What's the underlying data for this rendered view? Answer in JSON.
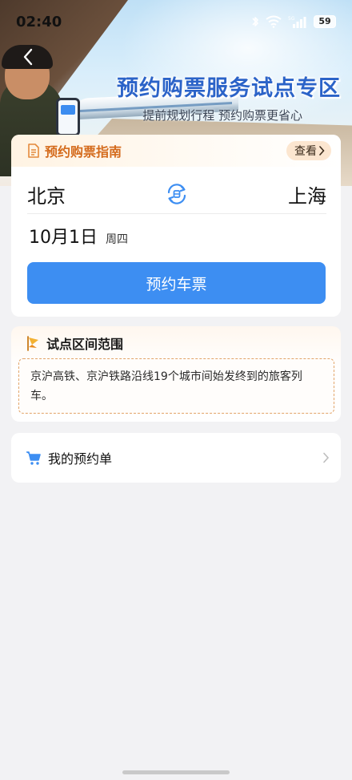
{
  "status_bar": {
    "time": "02:40",
    "battery": "59",
    "icons": [
      "bluetooth-icon",
      "wifi-icon",
      "signal-5g-icon",
      "battery-icon"
    ]
  },
  "hero": {
    "title": "预约购票服务试点专区",
    "subtitle": "提前规划行程 预约购票更省心"
  },
  "guide": {
    "title": "预约购票指南",
    "view_label": "查看"
  },
  "route": {
    "from": "北京",
    "to": "上海"
  },
  "date": {
    "date": "10月1日",
    "weekday": "周四"
  },
  "booking": {
    "button_label": "预约车票"
  },
  "scope": {
    "title": "试点区间范围",
    "description": "京沪高铁、京沪铁路沿线19个城市间始发终到的旅客列车。"
  },
  "orders": {
    "label": "我的预约单"
  },
  "colors": {
    "primary_blue": "#3d8ef2",
    "accent_orange": "#d46a1b",
    "title_blue": "#2b63c8",
    "background": "#f2f2f4"
  }
}
